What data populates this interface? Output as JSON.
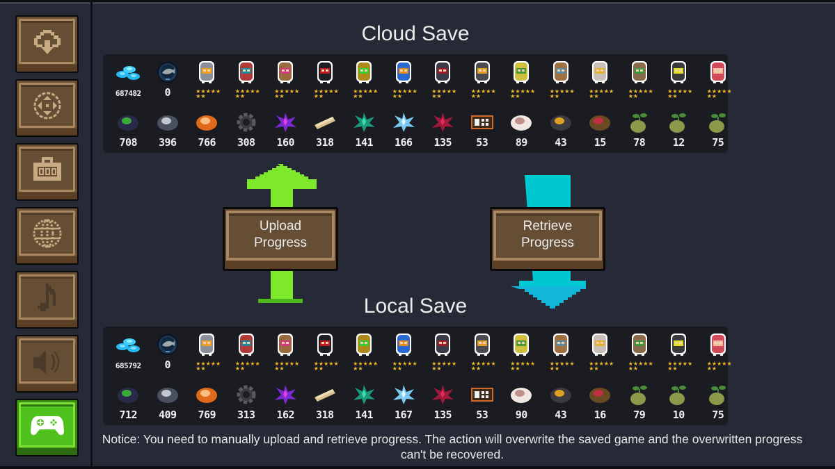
{
  "sidebar": {
    "items": [
      {
        "icon": "cloud-download-icon",
        "label": "Cloud Save",
        "active": false
      },
      {
        "icon": "dpad-icon",
        "label": "Controls",
        "active": false
      },
      {
        "icon": "toolbox-icon",
        "label": "Equipment",
        "active": false
      },
      {
        "icon": "globe-icon",
        "label": "Language",
        "active": false
      },
      {
        "icon": "music-note-icon",
        "label": "Music",
        "active": false
      },
      {
        "icon": "speaker-icon",
        "label": "Sound",
        "active": false
      },
      {
        "icon": "gamepad-icon",
        "label": "Game Services",
        "active": true
      }
    ]
  },
  "cloud": {
    "title": "Cloud Save",
    "gems": "687482",
    "fish": "0",
    "characters": [
      {
        "name": "knight",
        "stars": "★★★★★\n★★"
      },
      {
        "name": "rogue",
        "stars": "★★★★★\n★★"
      },
      {
        "name": "wizard",
        "stars": "★★★★★\n★★"
      },
      {
        "name": "assassin",
        "stars": "★★★★★\n★★"
      },
      {
        "name": "alchemist",
        "stars": "★★★★★\n★★"
      },
      {
        "name": "engineer",
        "stars": "★★★★★\n★★"
      },
      {
        "name": "vampire",
        "stars": "★★★★★\n★★"
      },
      {
        "name": "paladin",
        "stars": "★★★★★\n★★"
      },
      {
        "name": "elf",
        "stars": "★★★★★\n★★"
      },
      {
        "name": "werewolf",
        "stars": "★★★★★\n★★"
      },
      {
        "name": "priest",
        "stars": "★★★★★\n★★"
      },
      {
        "name": "druid",
        "stars": "★★★★★\n★★"
      },
      {
        "name": "robot",
        "stars": "★★★★★\n★★"
      },
      {
        "name": "berserker",
        "stars": "★★★★★\n★★"
      }
    ],
    "materials": [
      {
        "name": "battery",
        "value": "708"
      },
      {
        "name": "iron-ore",
        "value": "396"
      },
      {
        "name": "copper-ore",
        "value": "766"
      },
      {
        "name": "gear",
        "value": "308"
      },
      {
        "name": "purple-crystal",
        "value": "160"
      },
      {
        "name": "timber",
        "value": "318"
      },
      {
        "name": "green-crystal",
        "value": "141"
      },
      {
        "name": "blue-crystal",
        "value": "166"
      },
      {
        "name": "red-crystal",
        "value": "135"
      },
      {
        "name": "chip",
        "value": "53"
      },
      {
        "name": "cotton",
        "value": "89"
      },
      {
        "name": "part",
        "value": "43"
      },
      {
        "name": "hammer",
        "value": "15"
      },
      {
        "name": "seed-a",
        "value": "78"
      },
      {
        "name": "seed-b",
        "value": "12"
      },
      {
        "name": "seed-c",
        "value": "75"
      }
    ]
  },
  "local": {
    "title": "Local Save",
    "gems": "685792",
    "fish": "0",
    "characters": [
      {
        "name": "knight",
        "stars": "★★★★★\n★★"
      },
      {
        "name": "rogue",
        "stars": "★★★★★\n★★"
      },
      {
        "name": "wizard",
        "stars": "★★★★★\n★★"
      },
      {
        "name": "assassin",
        "stars": "★★★★★\n★★"
      },
      {
        "name": "alchemist",
        "stars": "★★★★★\n★★"
      },
      {
        "name": "engineer",
        "stars": "★★★★★\n★★"
      },
      {
        "name": "vampire",
        "stars": "★★★★★\n★★"
      },
      {
        "name": "paladin",
        "stars": "★★★★★\n★★"
      },
      {
        "name": "elf",
        "stars": "★★★★★\n★★"
      },
      {
        "name": "werewolf",
        "stars": "★★★★★\n★★"
      },
      {
        "name": "priest",
        "stars": "★★★★★\n★★"
      },
      {
        "name": "druid",
        "stars": "★★★★★\n★★"
      },
      {
        "name": "robot",
        "stars": "★★★★★\n★★"
      },
      {
        "name": "berserker",
        "stars": "★★★★★\n★★"
      }
    ],
    "materials": [
      {
        "name": "battery",
        "value": "712"
      },
      {
        "name": "iron-ore",
        "value": "409"
      },
      {
        "name": "copper-ore",
        "value": "769"
      },
      {
        "name": "gear",
        "value": "313"
      },
      {
        "name": "purple-crystal",
        "value": "162"
      },
      {
        "name": "timber",
        "value": "318"
      },
      {
        "name": "green-crystal",
        "value": "141"
      },
      {
        "name": "blue-crystal",
        "value": "167"
      },
      {
        "name": "red-crystal",
        "value": "135"
      },
      {
        "name": "chip",
        "value": "53"
      },
      {
        "name": "cotton",
        "value": "90"
      },
      {
        "name": "part",
        "value": "43"
      },
      {
        "name": "hammer",
        "value": "16"
      },
      {
        "name": "seed-a",
        "value": "79"
      },
      {
        "name": "seed-b",
        "value": "10"
      },
      {
        "name": "seed-c",
        "value": "75"
      }
    ]
  },
  "actions": {
    "upload_label": "Upload\nProgress",
    "retrieve_label": "Retrieve\nProgress",
    "upload_color": "#7ee82a",
    "retrieve_color": "#00c8d0"
  },
  "notice": "Notice: You need to manually upload and retrieve progress. The action will overwrite the saved game and the overwritten progress\ncan't be recovered."
}
